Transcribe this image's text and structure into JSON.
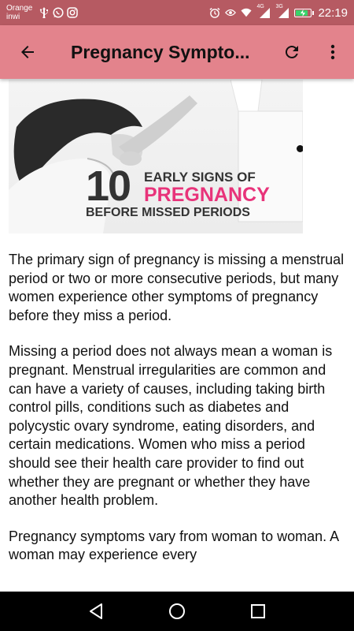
{
  "status_bar": {
    "carrier_line1": "Orange",
    "carrier_line2": "inwi",
    "time": "22:19",
    "network_4g": "4G",
    "network_3g": "3G",
    "battery_color": "#39d36a"
  },
  "app_bar": {
    "title": "Pregnancy Sympto...",
    "back_icon": "arrow-left-icon",
    "refresh_icon": "refresh-icon",
    "menu_icon": "more-vert-icon",
    "color": "#e3838c"
  },
  "article": {
    "image": {
      "number": "10",
      "line1": "EARLY SIGNS OF",
      "line2": "PREGNANCY",
      "line3": "BEFORE MISSED PERIODS",
      "accent": "#e8337a"
    },
    "paragraphs": [
      "The primary sign of pregnancy is missing a menstrual period or two or more consecutive periods, but many women experience other symptoms of pregnancy before they miss a period.",
      "Missing a period does not always mean a woman is pregnant. Menstrual irregularities are common and can have a variety of causes, including taking birth control pills, conditions such as diabetes and polycystic ovary syndrome, eating disorders, and certain medications. Women who miss a period should see their health care provider to find out whether they are pregnant or whether they have another health problem.",
      "Pregnancy symptoms vary from woman to woman. A woman may experience every"
    ]
  },
  "nav_bar": {
    "back_icon": "triangle-back-icon",
    "home_icon": "circle-home-icon",
    "recents_icon": "square-recents-icon"
  }
}
